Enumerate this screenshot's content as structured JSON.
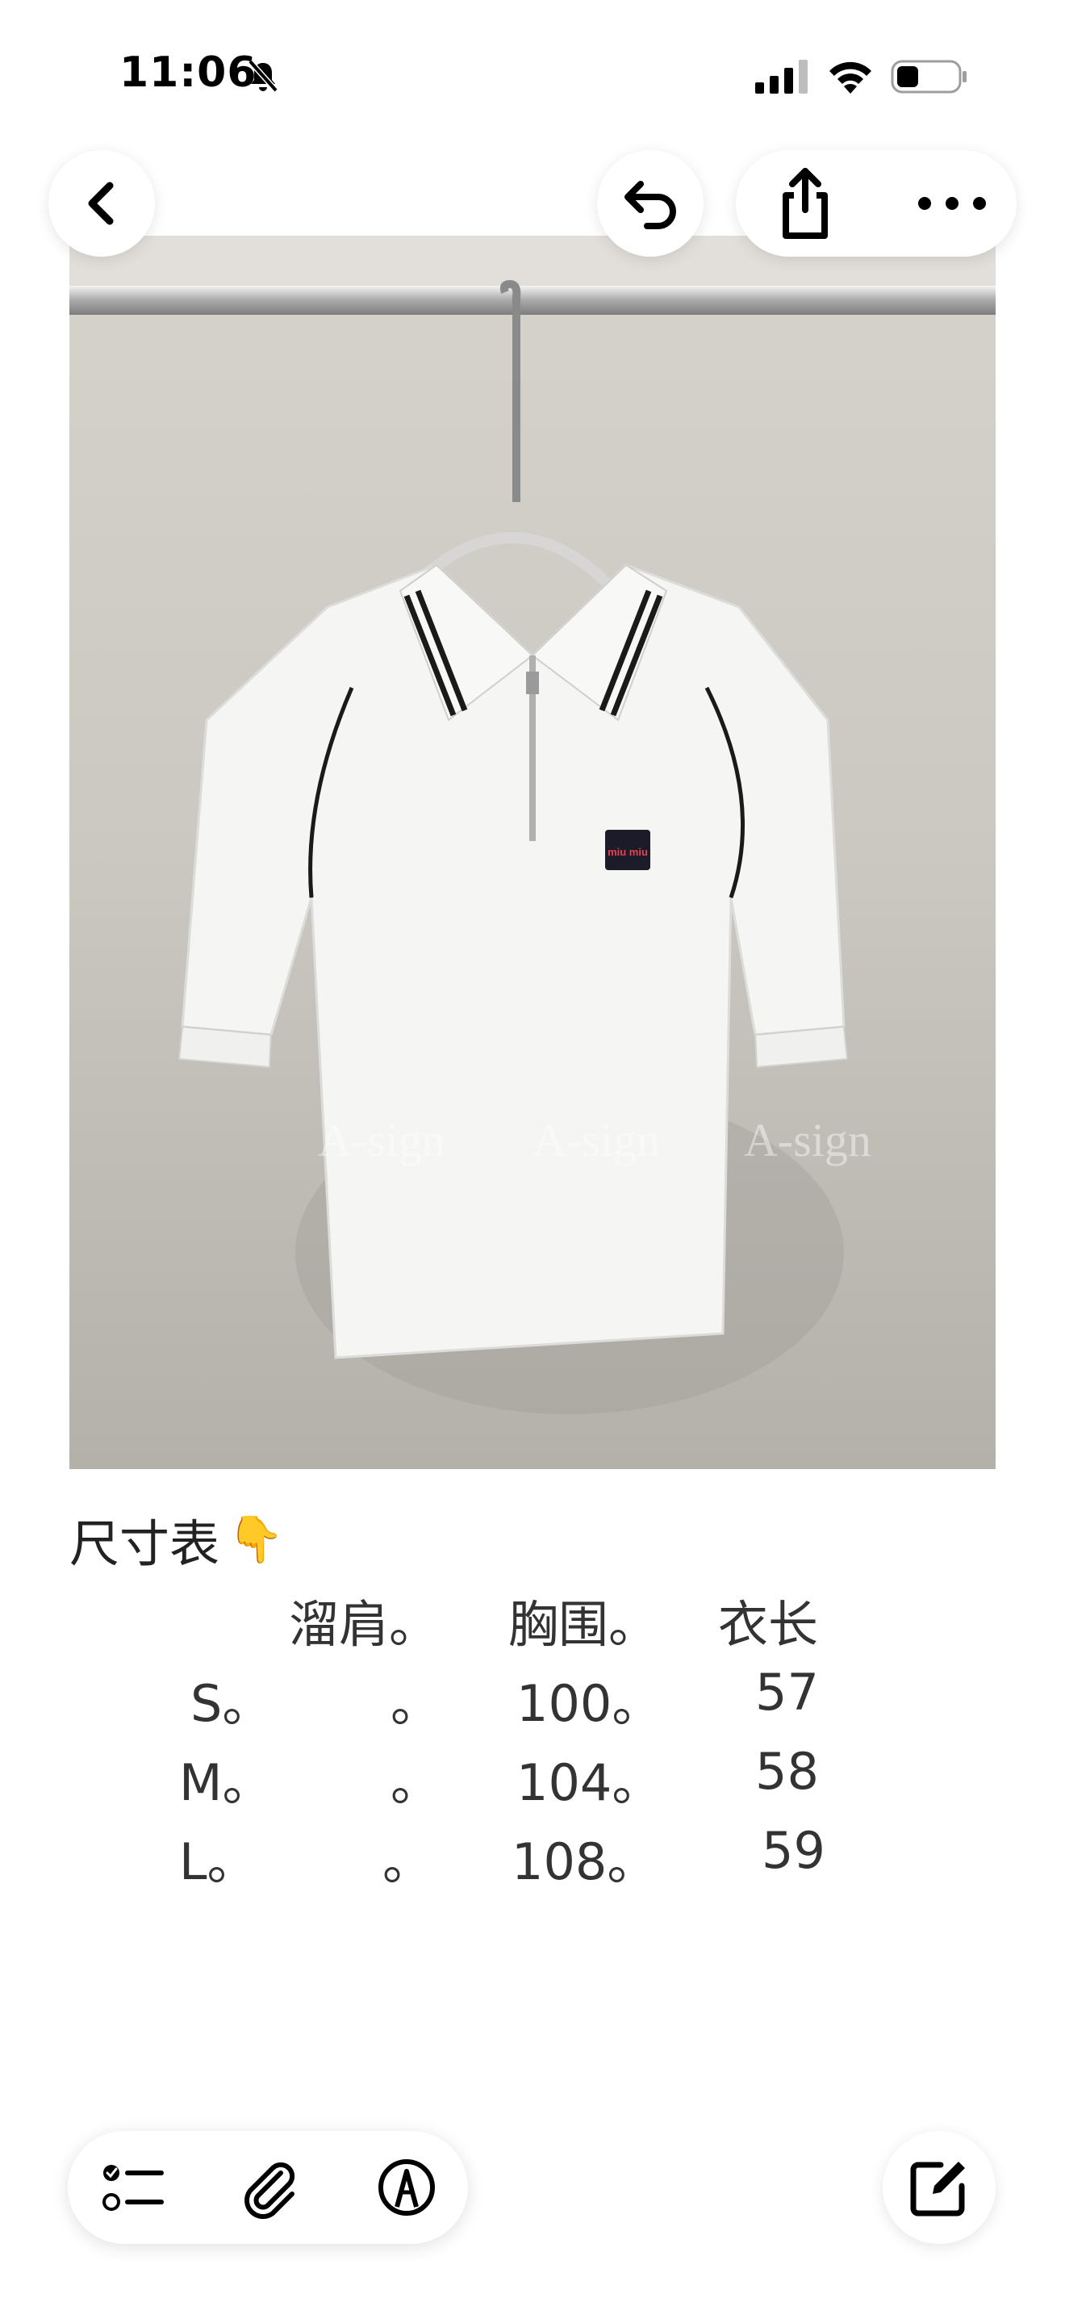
{
  "status_bar": {
    "time": "11:06",
    "icons": [
      "bell-slash-icon",
      "signal-icon",
      "wifi-icon",
      "battery-icon"
    ]
  },
  "nav": {
    "icons": [
      "chevron-left-icon",
      "undo-icon",
      "share-icon",
      "ellipsis-icon"
    ]
  },
  "photo": {
    "watermarks": [
      "A-sign",
      "A-sign",
      "A-sign"
    ],
    "logo_text": "miu miu"
  },
  "note": {
    "heading": "尺寸表",
    "heading_emoji": "👇",
    "table": {
      "headers": [
        "溜肩。",
        "胸围。",
        "衣长"
      ],
      "rows": [
        {
          "size": "S。",
          "shoulder": "。",
          "chest": "100。",
          "length": "57"
        },
        {
          "size": "M。",
          "shoulder": "。",
          "chest": "104。",
          "length": "58"
        },
        {
          "size": "L。",
          "shoulder": "。",
          "chest": "108。",
          "length": "59"
        }
      ]
    }
  },
  "toolbar": {
    "icons": [
      "checklist-icon",
      "paperclip-icon",
      "markup-pen-icon",
      "compose-icon"
    ]
  },
  "colors": {
    "accent_text": "#222222",
    "muted_text": "#333333",
    "background": "#ffffff"
  }
}
